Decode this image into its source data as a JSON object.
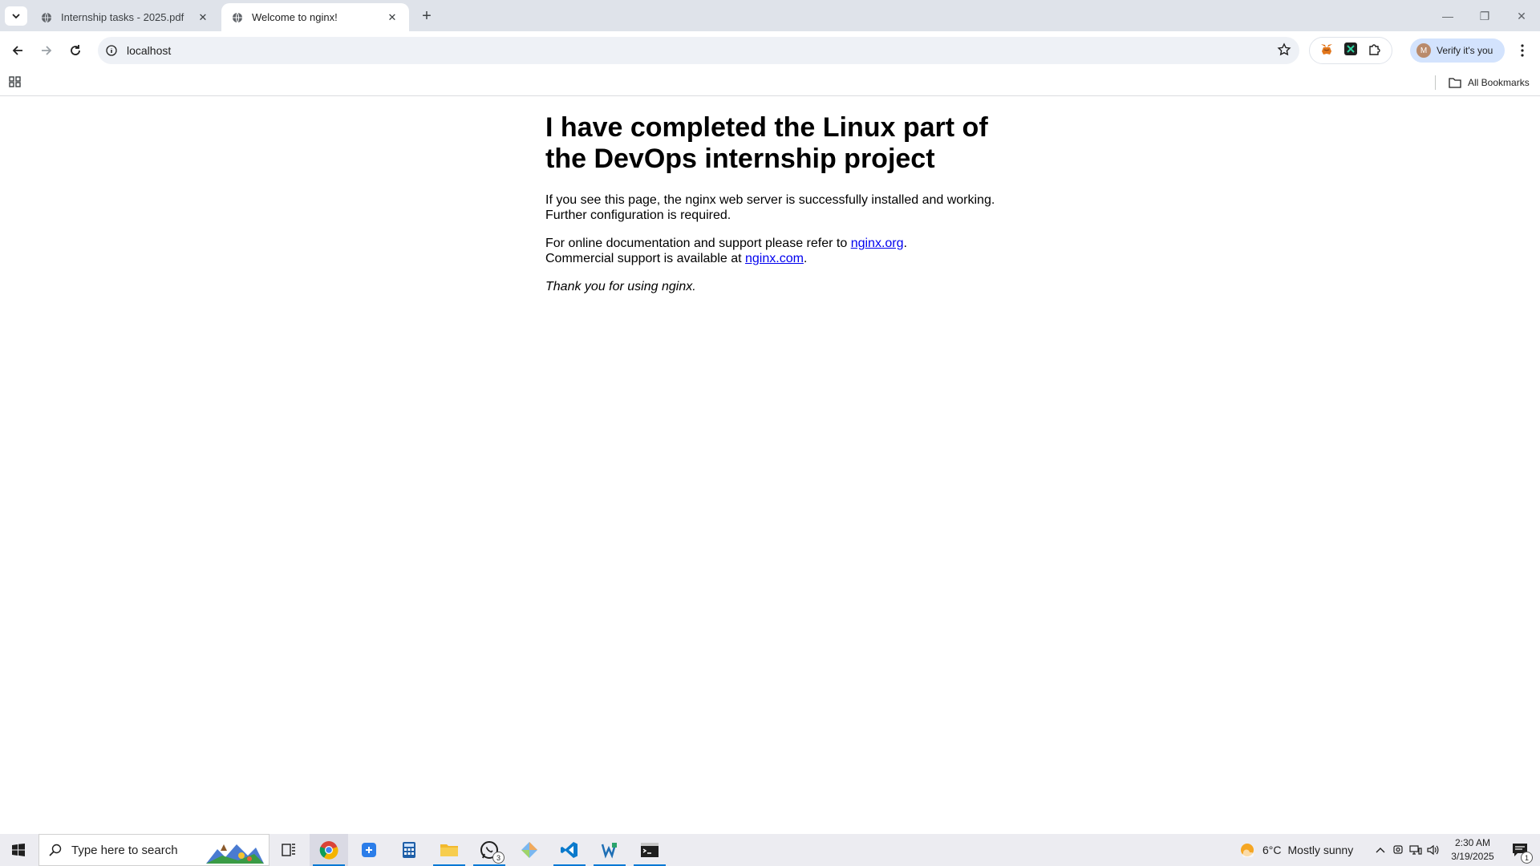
{
  "browser": {
    "tabs": [
      {
        "title": "Internship tasks - 2025.pdf",
        "active": false
      },
      {
        "title": "Welcome to nginx!",
        "active": true
      }
    ],
    "url": "localhost",
    "profile_button": "Verify it's you",
    "profile_initial": "M",
    "bookmarks_label": "All Bookmarks"
  },
  "page": {
    "heading": "I have completed the Linux part of the DevOps internship project",
    "para1": "If you see this page, the nginx web server is successfully installed and working. Further configuration is required.",
    "para2_prefix": "For online documentation and support please refer to ",
    "para2_link1": "nginx.org",
    "para2_mid": ".",
    "para2_line2": "Commercial support is available at ",
    "para2_link2": "nginx.com",
    "para2_suffix": ".",
    "thanks": "Thank you for using nginx."
  },
  "taskbar": {
    "search_placeholder": "Type here to search",
    "whatsapp_badge": "3",
    "weather_temp": "6°C",
    "weather_desc": "Mostly sunny",
    "time": "2:30 AM",
    "date": "3/19/2025",
    "notification_count": "1"
  },
  "colors": {
    "link": "#0000ee",
    "tabstrip": "#dfe3ea",
    "verify_bg": "#d3e3fd",
    "taskbar": "#ececf1",
    "accent": "#0078d4"
  },
  "icons": [
    "tab-list-icon",
    "globe-icon",
    "close-icon",
    "plus-icon",
    "minimize-icon",
    "restore-icon",
    "back-icon",
    "forward-icon",
    "reload-icon",
    "info-icon",
    "star-icon",
    "metamask-icon",
    "extension-x-icon",
    "puzzle-icon",
    "kebab-icon",
    "apps-icon",
    "folder-icon",
    "windows-icon",
    "search-icon",
    "task-view-icon",
    "chrome-icon",
    "whatsapp-icon",
    "vscode-icon",
    "terminal-icon",
    "weather-icon",
    "notification-icon"
  ]
}
